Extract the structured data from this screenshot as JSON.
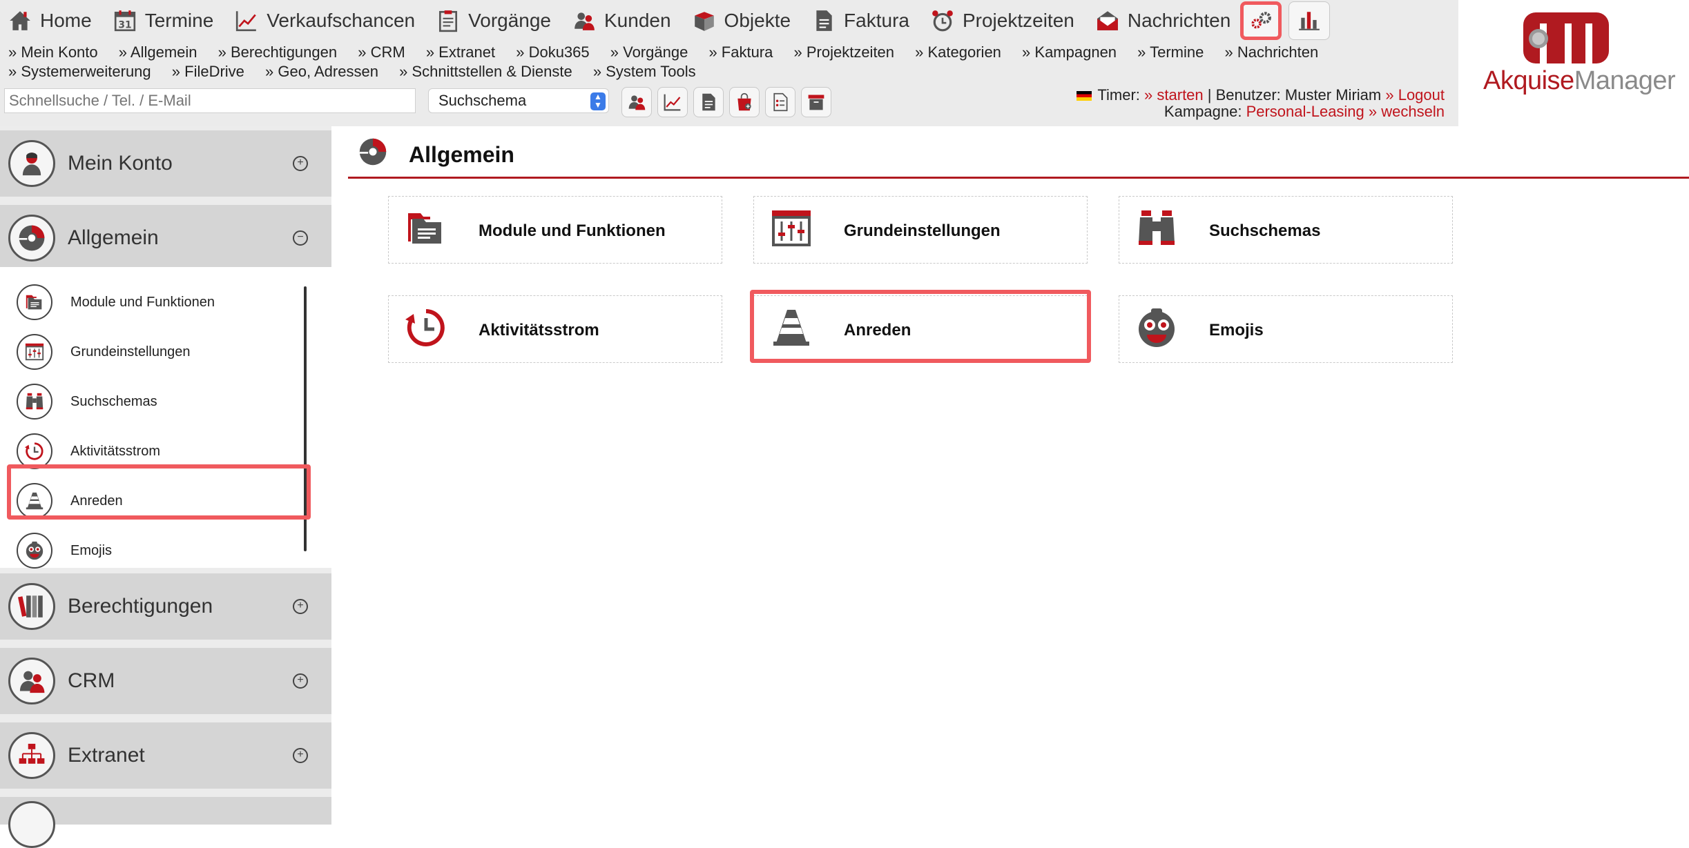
{
  "nav": {
    "items": [
      {
        "label": "Home",
        "icon": "home-icon"
      },
      {
        "label": "Termine",
        "icon": "calendar-icon"
      },
      {
        "label": "Verkaufschancen",
        "icon": "chart-line-icon"
      },
      {
        "label": "Vorgänge",
        "icon": "clipboard-icon"
      },
      {
        "label": "Kunden",
        "icon": "people-icon"
      },
      {
        "label": "Objekte",
        "icon": "box-icon"
      },
      {
        "label": "Faktura",
        "icon": "document-icon"
      },
      {
        "label": "Projektzeiten",
        "icon": "alarm-clock-icon"
      },
      {
        "label": "Nachrichten",
        "icon": "envelope-icon"
      }
    ],
    "buttons": [
      {
        "icon": "gears-icon",
        "active": true
      },
      {
        "icon": "bar-chart-icon",
        "active": false
      }
    ]
  },
  "subnav": [
    "» Mein Konto",
    "» Allgemein",
    "» Berechtigungen",
    "» CRM",
    "» Extranet",
    "» Doku365",
    "» Vorgänge",
    "» Faktura",
    "» Projektzeiten",
    "» Kategorien",
    "» Kampagnen",
    "» Termine",
    "» Nachrichten",
    "» Systemerweiterung",
    "» FileDrive",
    "» Geo, Adressen",
    "» Schnittstellen & Dienste",
    "» System Tools"
  ],
  "search": {
    "placeholder": "Schnellsuche / Tel. / E-Mail",
    "schema_value": "Suchschema"
  },
  "toolbar": {
    "icons": [
      "contacts-icon",
      "chart-line-icon",
      "document-icon",
      "shopping-bag-icon",
      "list-document-icon",
      "archive-icon"
    ]
  },
  "userinfo": {
    "timer_label": "Timer:",
    "timer_action": "» starten",
    "user_label": "| Benutzer: Muster Miriam",
    "logout": "» Logout",
    "campaign_label": "Kampagne:",
    "campaign_name": "Personal-Leasing",
    "campaign_change": "» wechseln"
  },
  "logo": {
    "part1": "Akquise",
    "part2": "Manager"
  },
  "sidebar": {
    "sections": [
      {
        "label": "Mein Konto",
        "toggle": "+",
        "icon": "user-icon"
      },
      {
        "label": "Allgemein",
        "toggle": "−",
        "icon": "disc-icon"
      },
      {
        "label": "Berechtigungen",
        "toggle": "+",
        "icon": "books-icon"
      },
      {
        "label": "CRM",
        "toggle": "+",
        "icon": "people-icon"
      },
      {
        "label": "Extranet",
        "toggle": "+",
        "icon": "network-icon"
      }
    ],
    "subitems": [
      {
        "label": "Module und Funktionen",
        "icon": "folder-icon"
      },
      {
        "label": "Grundeinstellungen",
        "icon": "sliders-icon"
      },
      {
        "label": "Suchschemas",
        "icon": "binoculars-icon"
      },
      {
        "label": "Aktivitätsstrom",
        "icon": "history-icon"
      },
      {
        "label": "Anreden",
        "icon": "traffic-cone-icon"
      },
      {
        "label": "Emojis",
        "icon": "emoji-face-icon"
      }
    ]
  },
  "main": {
    "title": "Allgemein",
    "title_icon": "disc-icon",
    "tiles": [
      {
        "label": "Module und Funktionen",
        "icon": "folder-icon"
      },
      {
        "label": "Grundeinstellungen",
        "icon": "sliders-icon"
      },
      {
        "label": "Suchschemas",
        "icon": "binoculars-icon"
      },
      {
        "label": "Aktivitätsstrom",
        "icon": "history-icon"
      },
      {
        "label": "Anreden",
        "icon": "traffic-cone-icon"
      },
      {
        "label": "Emojis",
        "icon": "emoji-face-icon"
      }
    ]
  },
  "colors": {
    "accent": "#b01a20",
    "highlight": "#f05a5e",
    "sidebar_section": "#d5d5d5"
  }
}
